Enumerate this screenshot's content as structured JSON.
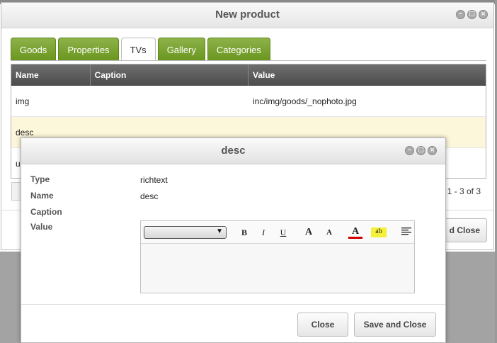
{
  "window": {
    "title": "New product",
    "controls": [
      "minimize-icon",
      "maximize-icon",
      "close-icon"
    ]
  },
  "tabs": [
    {
      "label": "Goods",
      "active": false
    },
    {
      "label": "Properties",
      "active": false
    },
    {
      "label": "TVs",
      "active": true
    },
    {
      "label": "Gallery",
      "active": false
    },
    {
      "label": "Categories",
      "active": false
    }
  ],
  "grid": {
    "columns": [
      "Name",
      "Caption",
      "Value"
    ],
    "rows": [
      {
        "name": "img",
        "caption": "",
        "value": "inc/img/goods/_nophoto.jpg"
      },
      {
        "name": "desc",
        "caption": "",
        "value": ""
      },
      {
        "name": "u",
        "caption": "",
        "value": ""
      }
    ],
    "paging": "g 1 - 3 of 3"
  },
  "outer_footer": {
    "save_label": "d Close"
  },
  "dialog": {
    "title": "desc",
    "fields": {
      "type_label": "Type",
      "type_value": "richtext",
      "name_label": "Name",
      "name_value": "desc",
      "caption_label": "Caption",
      "caption_value": "",
      "value_label": "Value"
    },
    "toolbar": {
      "font_select": "",
      "bold": "B",
      "italic": "I",
      "underline": "U",
      "grow": "A",
      "shrink": "A",
      "color": "A",
      "highlight": "ab"
    },
    "close_label": "Close",
    "save_label": "Save and Close"
  },
  "colors": {
    "tab_green": "#7aa42f",
    "header_dark": "#5a5a5a",
    "selected_row": "#fcf6db",
    "text_red": "#d00000",
    "highlight_yellow": "#f5f03a"
  }
}
